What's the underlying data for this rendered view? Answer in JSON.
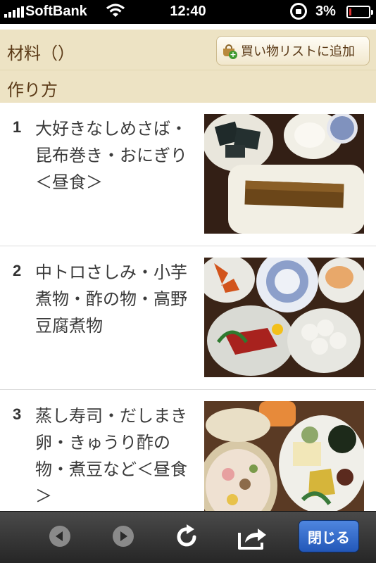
{
  "status_bar": {
    "carrier": "SoftBank",
    "time": "12:40",
    "battery_percent": "3%"
  },
  "ingredients": {
    "title": "材料（）",
    "add_to_list_label": "買い物リストに追加"
  },
  "method": {
    "title": "作り方"
  },
  "steps": [
    {
      "number": "1",
      "text": "大好きなしめさば・昆布巻き・おにぎり＜昼食＞"
    },
    {
      "number": "2",
      "text": "中トロさしみ・小芋煮物・酢の物・高野豆腐煮物"
    },
    {
      "number": "3",
      "text": "蒸し寿司・だしまき卵・きゅうり酢の物・煮豆など＜昼食＞"
    }
  ],
  "toolbar": {
    "close_label": "閉じる"
  },
  "colors": {
    "header_bg": "#ede3c4",
    "header_text": "#5b3a17",
    "close_button": "#2f64c4"
  }
}
